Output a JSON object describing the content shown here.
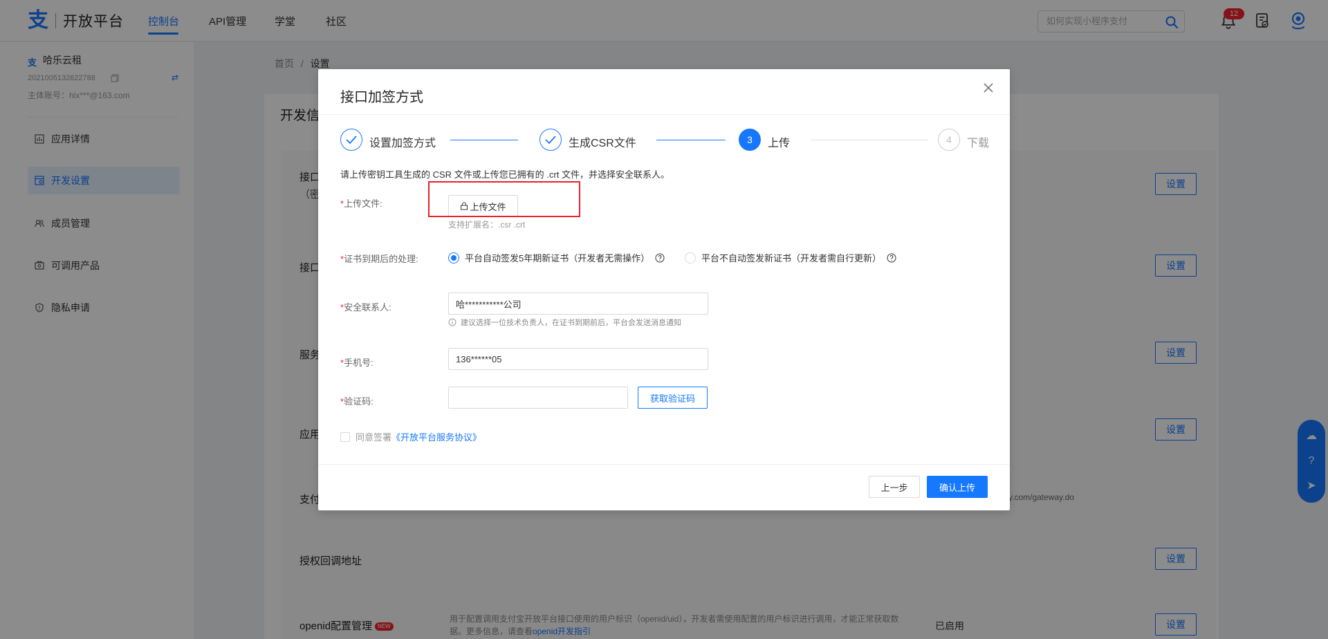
{
  "topnav": {
    "logo_text": "开放平台",
    "items": [
      {
        "label": "控制台"
      },
      {
        "label": "API管理"
      },
      {
        "label": "学堂"
      },
      {
        "label": "社区"
      }
    ],
    "search_placeholder": "如何实现小程序支付",
    "notification_count": "12"
  },
  "sidebar": {
    "account_name": "哈乐云租",
    "account_id": "2021005132622788",
    "main_account": "主体账号：hlx***@163.com",
    "items": [
      {
        "label": "应用详情",
        "icon": "app-detail-icon"
      },
      {
        "label": "开发设置",
        "icon": "dev-settings-icon"
      },
      {
        "label": "成员管理",
        "icon": "members-icon"
      },
      {
        "label": "可调用产品",
        "icon": "products-icon"
      },
      {
        "label": "隐私申请",
        "icon": "privacy-icon"
      }
    ]
  },
  "breadcrumb": {
    "home": "首页",
    "sep": "/",
    "current": "设置"
  },
  "content": {
    "card_title": "开发信",
    "rows": [
      {
        "label": "接口"
      },
      {
        "label": "（密"
      },
      {
        "label": "接口"
      },
      {
        "label": "服务"
      },
      {
        "label": "应用"
      },
      {
        "label": "支付"
      },
      {
        "label": "授权回调地址"
      },
      {
        "label": "openid配置管理"
      }
    ],
    "set_label": "设置",
    "gateway_tail": "y.com/gateway.do",
    "new_badge": "NEW",
    "openid_desc": "用于配置调用支付宝开放平台接口使用的用户标识（openid/uid），开发者需使用配置的用户标识进行调用，才能正常获取数据。更多信息，请查看",
    "openid_link": "openid开发指引",
    "openid_status": "已启用"
  },
  "modal": {
    "title": "接口加签方式",
    "steps": [
      {
        "num": "1",
        "label": "设置加签方式",
        "state": "done"
      },
      {
        "num": "2",
        "label": "生成CSR文件",
        "state": "done"
      },
      {
        "num": "3",
        "label": "上传",
        "state": "current"
      },
      {
        "num": "4",
        "label": "下载",
        "state": "wait"
      }
    ],
    "intro": "请上传密钥工具生成的 CSR 文件或上传您已拥有的 .crt 文件，并选择安全联系人。",
    "required_mark": "*",
    "upload": {
      "label": "上传文件:",
      "button": "上传文件",
      "hint": "支持扩展名：.csr .crt"
    },
    "expiry": {
      "label": "证书到期后的处理:",
      "option_auto": "平台自动签发5年期新证书（开发者无需操作）",
      "option_manual": "平台不自动签发新证书（开发者需自行更新）"
    },
    "contact": {
      "label": "安全联系人:",
      "value": "哈***********公司",
      "tip": "建议选择一位技术负责人，在证书到期前后，平台会发送消息通知"
    },
    "phone": {
      "label": "手机号:",
      "value": "136******05"
    },
    "code": {
      "label": "验证码:",
      "value": "",
      "button": "获取验证码"
    },
    "agree": {
      "prefix": "同意签署",
      "link": "《开放平台服务协议》"
    },
    "prev_button": "上一步",
    "confirm_button": "确认上传"
  },
  "colors": {
    "accent": "#1677ff",
    "danger": "#f5222d",
    "highlight_box": "#e8202e"
  }
}
